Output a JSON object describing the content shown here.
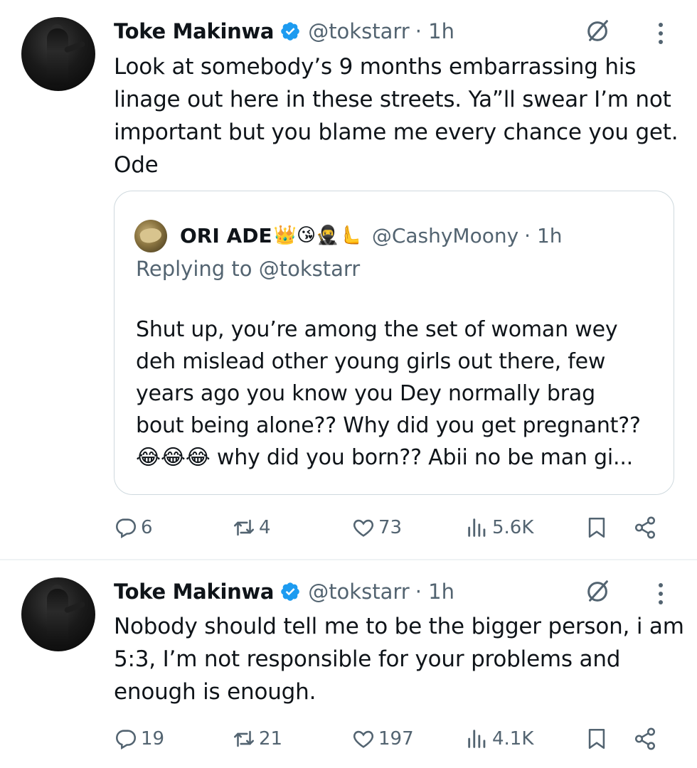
{
  "tweets": [
    {
      "author": "Toke Makinwa",
      "handle": "@tokstarr",
      "time": "· 1h",
      "text_lines": [
        "Look at somebody’s 9 months embarrassing his",
        "linage out here in these streets. Ya”ll swear I’m not",
        "important but you blame me every chance you get.",
        "Ode"
      ],
      "quote": {
        "author": "ORI ADE",
        "emojis": "👑😘🥷🫷",
        "handle": "@CashyMoony",
        "time": "· 1h",
        "replying_to": "Replying to @tokstarr",
        "text_lines": [
          "Shut up, you’re among the set of woman wey",
          "deh mislead other young girls out there, few",
          "years ago you know you Dey normally brag",
          "bout being alone?? Why did you get pregnant??",
          "😂😂😂 why did you born?? Abii no be man gi..."
        ]
      },
      "stats": {
        "replies": "6",
        "reposts": "4",
        "likes": "73",
        "views": "5.6K"
      }
    },
    {
      "author": "Toke Makinwa",
      "handle": "@tokstarr",
      "time": "· 1h",
      "text_lines": [
        "Nobody should tell me to be the bigger person, i am",
        "5:3, I’m not responsible for your problems and",
        "enough is enough."
      ],
      "stats": {
        "replies": "19",
        "reposts": "21",
        "likes": "197",
        "views": "4.1K"
      }
    }
  ],
  "icons": {
    "verified": "verified-badge-icon",
    "grok": "grok-icon",
    "more": "more-vertical-icon",
    "reply": "reply-icon",
    "repost": "repost-icon",
    "like": "like-icon",
    "views": "views-icon",
    "bookmark": "bookmark-icon",
    "share": "share-icon"
  },
  "colors": {
    "verified": "#1d9bf0",
    "secondary_text": "#536471",
    "border": "#cfd9de"
  }
}
